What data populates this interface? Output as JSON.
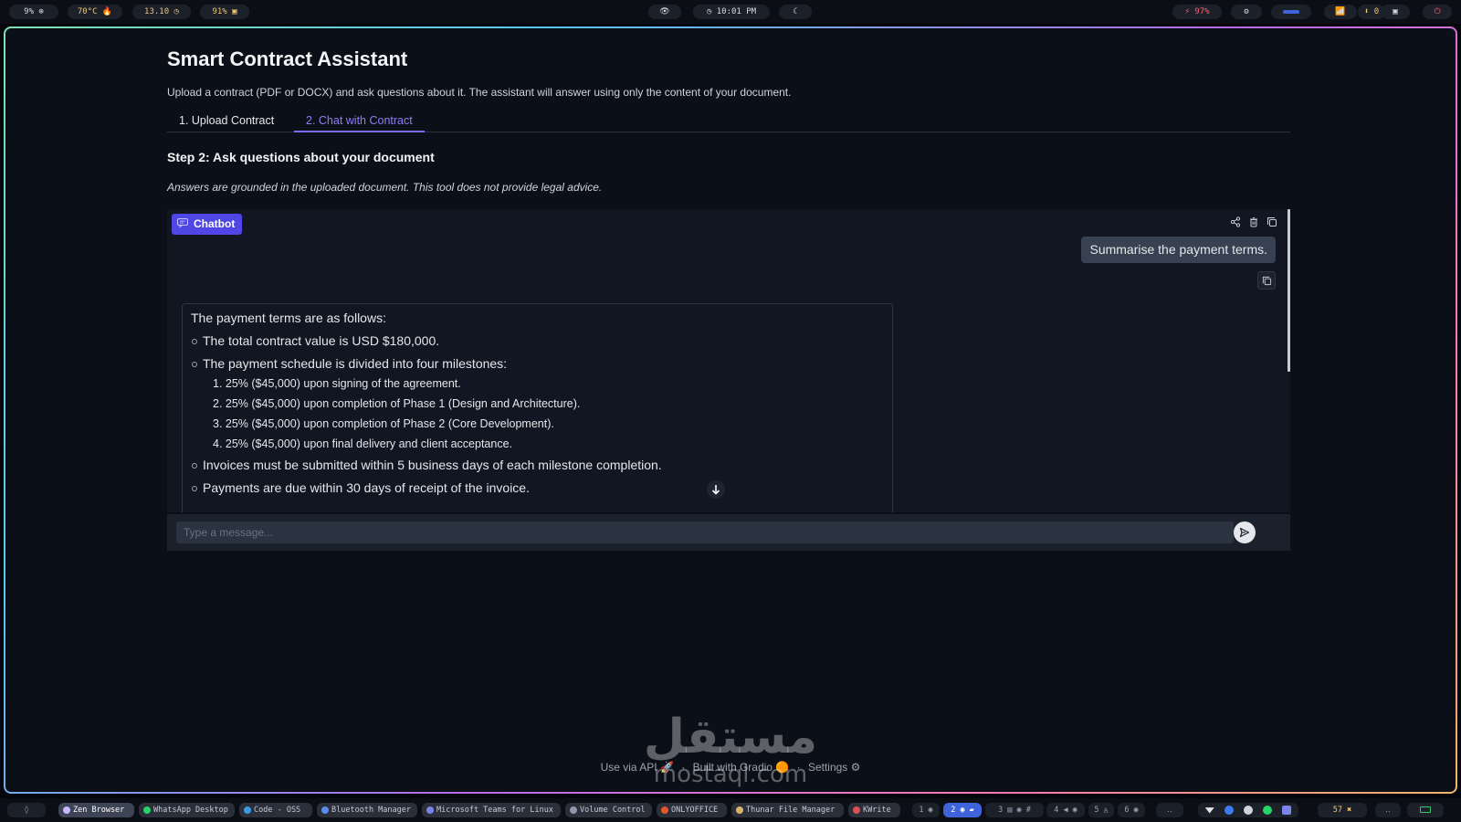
{
  "topbar": {
    "cpu": "9% ⊕",
    "temp": "70°C 🔥",
    "load": "13.10 ◷",
    "memory": "91% ▣",
    "eye_off": "👁",
    "clock": "◷ 10:01 PM",
    "mode": "☾",
    "battery": "⚡ 97%",
    "settings": "⚙",
    "network": "📶",
    "updates": "⬇ 0",
    "screen": "▣",
    "power": "⏻"
  },
  "app": {
    "title": "Smart Contract Assistant",
    "description": "Upload a contract (PDF or DOCX) and ask questions about it. The assistant will answer using only the content of your document.",
    "tabs": [
      "1. Upload Contract",
      "2. Chat with Contract"
    ],
    "active_tab": 1,
    "step_heading": "Step 2: Ask questions about your document",
    "disclaimer": "Answers are grounded in the uploaded document. This tool does not provide legal advice."
  },
  "chat": {
    "badge_label": "Chatbot",
    "tools": [
      "share-icon",
      "trash-icon",
      "copy-icon"
    ],
    "user_message": "Summarise the payment terms.",
    "bot_intro": "The payment terms are as follows:",
    "bullets": [
      "The total contract value is USD $180,000.",
      "The payment schedule is divided into four milestones:"
    ],
    "milestones": [
      "1. 25% ($45,000) upon signing of the agreement.",
      "2. 25% ($45,000) upon completion of Phase 1 (Design and Architecture).",
      "3. 25% ($45,000) upon completion of Phase 2 (Core Development).",
      "4. 25% ($45,000) upon final delivery and client acceptance."
    ],
    "bullets_after": [
      "Invoices must be submitted within 5 business days of each milestone completion.",
      "Payments are due within 30 days of receipt of the invoice."
    ]
  },
  "input": {
    "placeholder": "Type a message..."
  },
  "footer": {
    "api": "Use via API 🚀",
    "built": "Built with Gradio 🟠",
    "settings": "Settings ⚙",
    "sep": "·"
  },
  "watermark": {
    "arabic": "مستقل",
    "url": "mostaql.com"
  },
  "taskbar": {
    "launcher": "◊",
    "apps": [
      "Zen Browser",
      "WhatsApp Desktop",
      "Code - OSS",
      "Bluetooth Manager",
      "Microsoft Teams for Linux",
      "Volume Control",
      "ONLYOFFICE",
      "Thunar File Manager",
      "KWrite"
    ],
    "workspaces": [
      "1 ◉",
      "2 ◉ ▰",
      "3 ▤ ◉ #",
      "4 ◀ ◉",
      "5 ◬",
      "6 ◉"
    ],
    "more": "‥",
    "tray_count": "57 ✖",
    "tray_extra": "‥"
  },
  "colors": {
    "accent": "#4f46e5",
    "tab_active": "#8f7ff5",
    "background": "#0b0f17",
    "panel": "#111622"
  }
}
